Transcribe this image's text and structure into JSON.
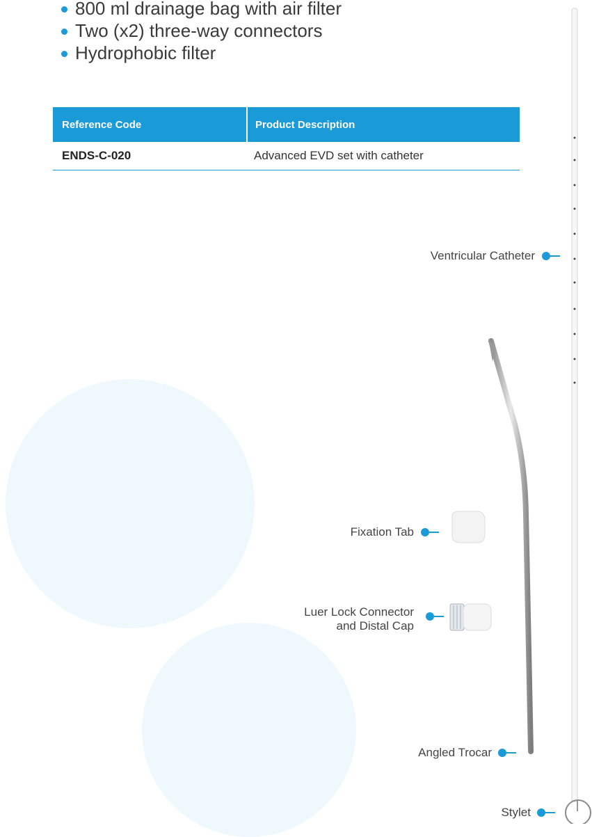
{
  "features": [
    "800 ml drainage bag with air filter",
    "Two (x2) three-way connectors",
    "Hydrophobic filter"
  ],
  "table": {
    "headers": [
      "Reference Code",
      "Product Description"
    ],
    "rows": [
      {
        "code": "ENDS-C-020",
        "description": "Advanced EVD set with catheter"
      }
    ]
  },
  "labels": {
    "ventricular_catheter": "Ventricular Catheter",
    "fixation_tab": "Fixation Tab",
    "luer_lock_line1": "Luer Lock Connector",
    "luer_lock_line2": "and Distal Cap",
    "angled_trocar": "Angled Trocar",
    "stylet": "Stylet"
  },
  "colors": {
    "accent": "#1a9ad6",
    "background_circle": "#eef8fd"
  }
}
